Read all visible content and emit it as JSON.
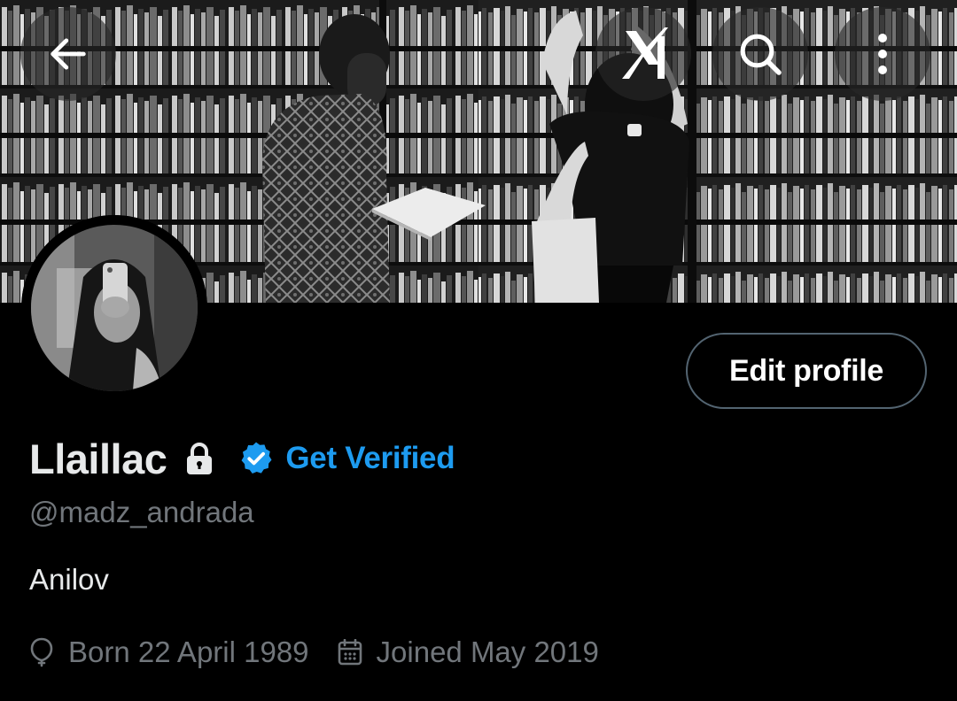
{
  "header": {
    "back_icon": "arrow-left-icon",
    "grok_icon": "xai-grok-icon",
    "search_icon": "search-icon",
    "more_icon": "more-vertical-icon"
  },
  "profile": {
    "display_name": "Llaillac",
    "protected_icon": "lock-icon",
    "verified_icon": "verified-badge-icon",
    "get_verified_label": "Get Verified",
    "handle": "@madz_andrada",
    "bio": "Anilov",
    "edit_profile_label": "Edit profile",
    "birthday": "Born 22 April 1989",
    "joined": "Joined May 2019"
  },
  "colors": {
    "background": "#000000",
    "primary_text": "#e7e9ea",
    "secondary_text": "#71767b",
    "accent": "#1d9bf0",
    "button_border": "#536471"
  }
}
